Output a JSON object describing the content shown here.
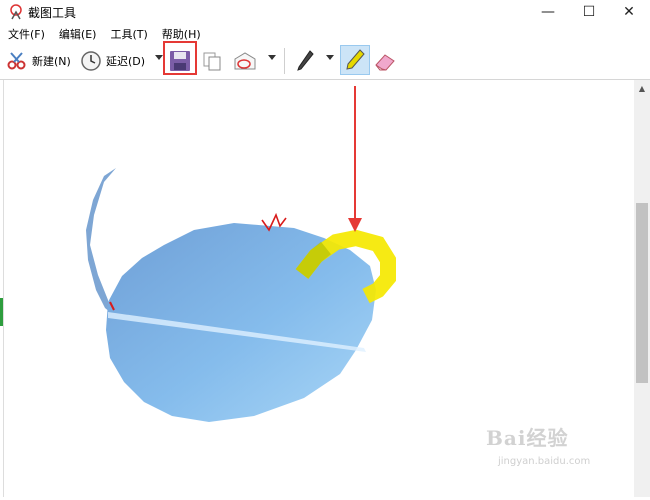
{
  "window": {
    "title": "截图工具",
    "controls": {
      "minimize": "—",
      "maximize": "☐",
      "close": "✕"
    }
  },
  "menu": {
    "items": [
      {
        "label": "文件(F)"
      },
      {
        "label": "编辑(E)"
      },
      {
        "label": "工具(T)"
      },
      {
        "label": "帮助(H)"
      }
    ]
  },
  "toolbar": {
    "new_label": "新建(N)",
    "delay_label": "延迟(D)",
    "icons": {
      "new": "scissors-icon",
      "delay": "clock-icon",
      "save": "save-icon",
      "copy": "copy-icon",
      "send": "send-icon",
      "pen": "pen-icon",
      "highlighter": "highlighter-icon",
      "eraser": "eraser-icon"
    },
    "selected_tool": "highlighter",
    "highlighted_button": "save"
  },
  "scrollbar": {
    "up_glyph": "▲"
  },
  "watermark": {
    "main": "Bai经验",
    "sub": "jingyan.baidu.com"
  },
  "colors": {
    "annotation_red": "#e53935",
    "highlighter_yellow": "#f5e800",
    "shape_blue": "#7fb4e6",
    "pen_red": "#d81b1b"
  }
}
